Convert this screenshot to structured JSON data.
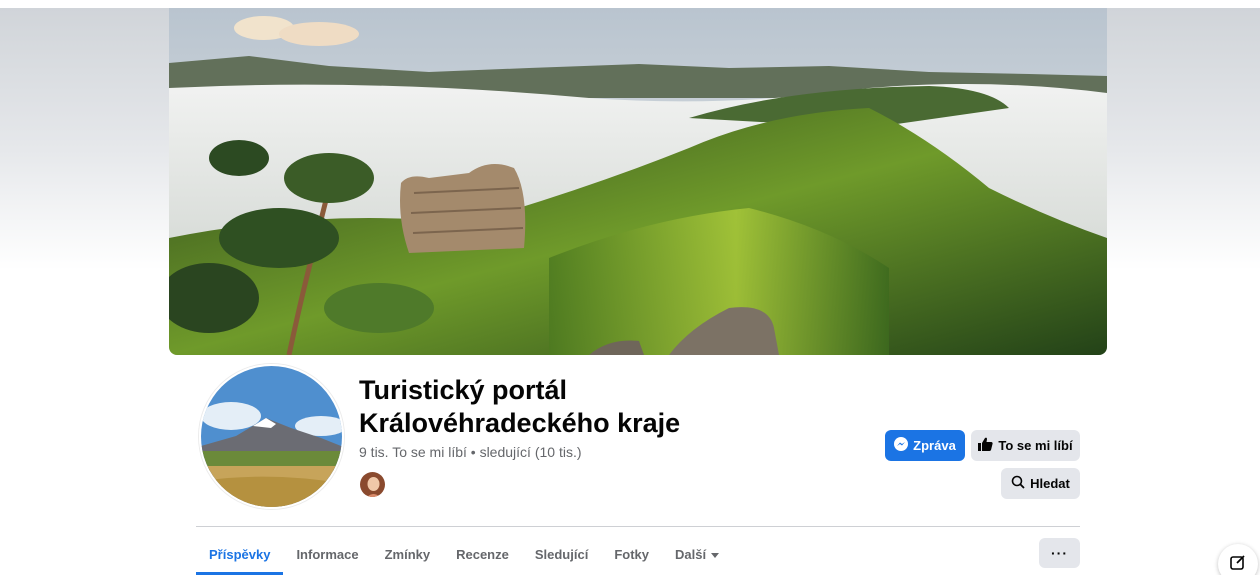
{
  "page": {
    "title_line1": "Turistický portál",
    "title_line2": "Královéhradeckého kraje",
    "stats": "9 tis. To se mi líbí • sledující (10 tis.)"
  },
  "actions": {
    "message": "Zpráva",
    "like": "To se mi líbí",
    "search": "Hledat",
    "more": "···"
  },
  "tabs": [
    {
      "label": "Příspěvky",
      "active": true
    },
    {
      "label": "Informace"
    },
    {
      "label": "Zmínky"
    },
    {
      "label": "Recenze"
    },
    {
      "label": "Sledující"
    },
    {
      "label": "Fotky"
    },
    {
      "label": "Další"
    }
  ],
  "icons": {
    "message": "messenger-icon",
    "like": "thumbs-up-icon",
    "search": "search-icon",
    "more_tab": "caret-down-icon",
    "compose": "compose-icon"
  },
  "colors": {
    "accent": "#1b74e4",
    "button_gray": "#e4e6eb",
    "text_secondary": "#65676b"
  }
}
